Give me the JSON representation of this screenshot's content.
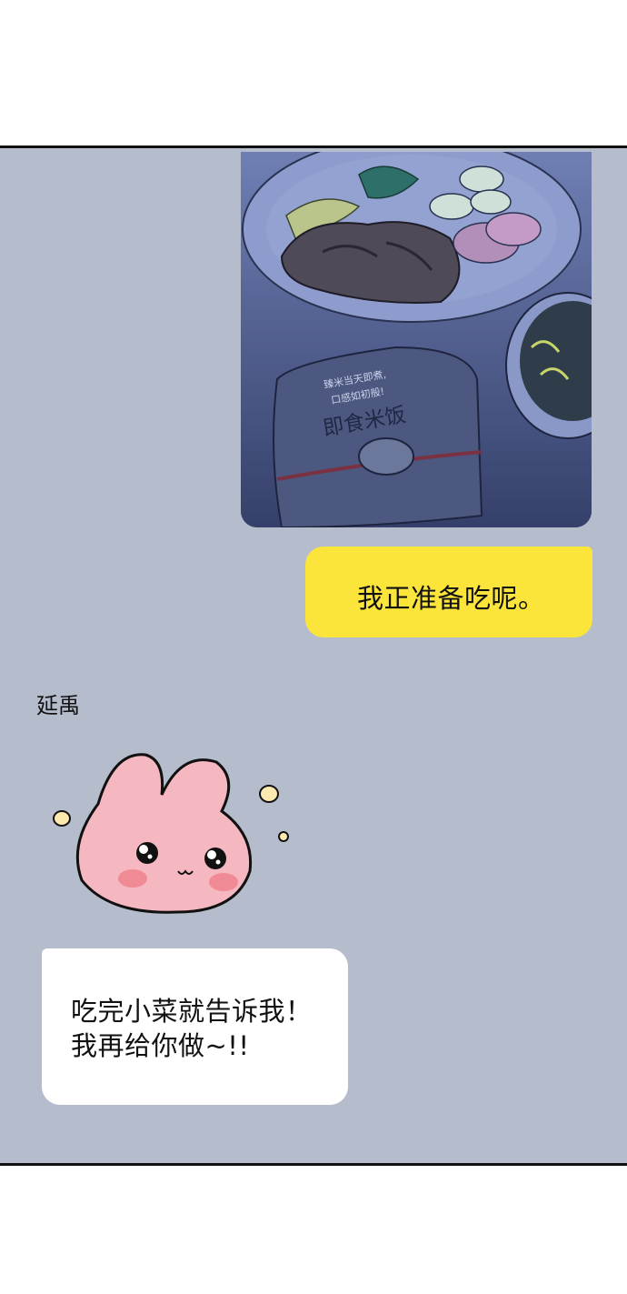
{
  "chat": {
    "outgoing": {
      "text": "我正准备吃呢。"
    },
    "sender_name": "延禹",
    "incoming": {
      "line1": "吃完小菜就告诉我！",
      "line2": "我再给你做~!!"
    }
  },
  "photo": {
    "package_label": "即食米饭",
    "package_small_text_1": "臻米当天即煮,",
    "package_small_text_2": "口感如初般!"
  },
  "colors": {
    "chat_background": "#b5bccb",
    "outgoing_bubble": "#fbe53a",
    "incoming_bubble": "#ffffff",
    "sticker_bunny": "#f6b8c0"
  }
}
